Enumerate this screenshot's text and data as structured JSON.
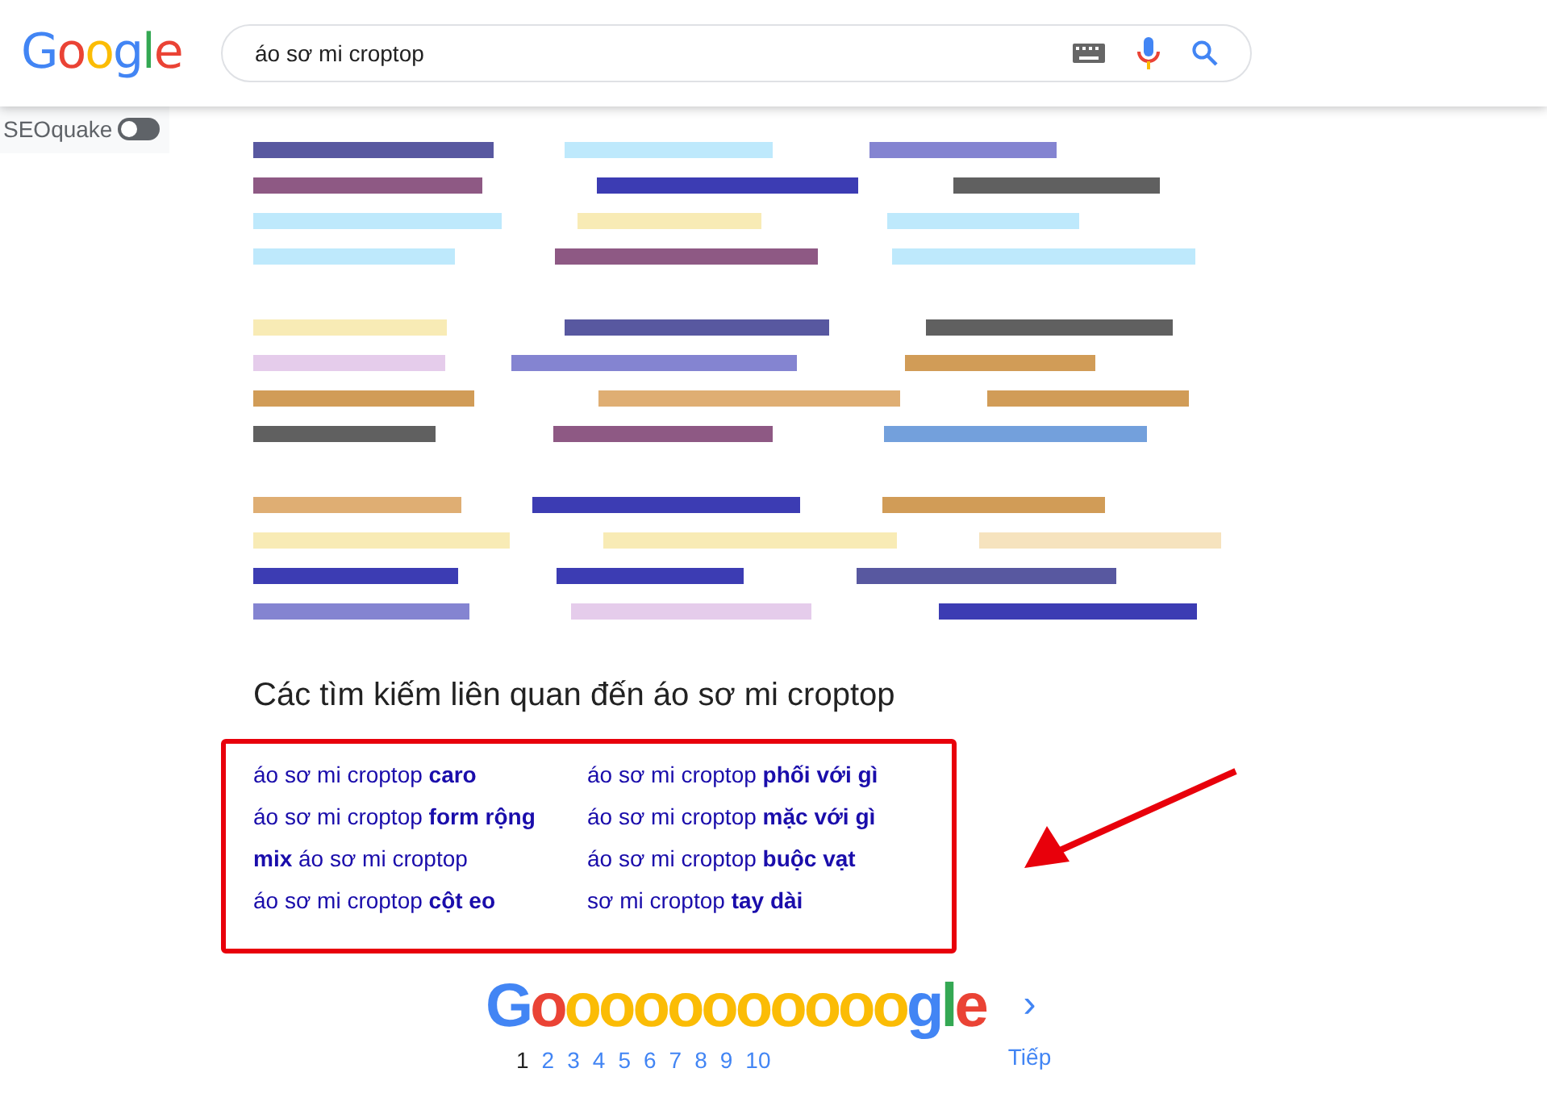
{
  "header": {
    "logo_letters": [
      {
        "text": "G",
        "color": "#4285f4"
      },
      {
        "text": "o",
        "color": "#ea4335"
      },
      {
        "text": "o",
        "color": "#fbbc05"
      },
      {
        "text": "g",
        "color": "#4285f4"
      },
      {
        "text": "l",
        "color": "#34a853"
      },
      {
        "text": "e",
        "color": "#ea4335"
      }
    ],
    "search": {
      "value": "áo sơ mi croptop"
    }
  },
  "seoquake": {
    "label": "SEOquake",
    "on": false
  },
  "related": {
    "title": "Các tìm kiếm liên quan đến áo sơ mi croptop",
    "columns": [
      [
        "áo sơ mi croptop **caro**",
        "áo sơ mi croptop **form rộng**",
        "**mix** áo sơ mi croptop",
        "áo sơ mi croptop **cột eo**"
      ],
      [
        "áo sơ mi croptop **phối với gì**",
        "áo sơ mi croptop **mặc với gì**",
        "áo sơ mi croptop **buộc vạt**",
        "sơ mi croptop **tay dài**"
      ]
    ]
  },
  "pagination": {
    "logo_letters": [
      {
        "text": "G",
        "color": "#4285f4"
      },
      {
        "text": "o",
        "color": "#ea4335"
      },
      {
        "text": "o",
        "color": "#fbbc05"
      },
      {
        "text": "o",
        "color": "#fbbc05"
      },
      {
        "text": "o",
        "color": "#fbbc05"
      },
      {
        "text": "o",
        "color": "#fbbc05"
      },
      {
        "text": "o",
        "color": "#fbbc05"
      },
      {
        "text": "o",
        "color": "#fbbc05"
      },
      {
        "text": "o",
        "color": "#fbbc05"
      },
      {
        "text": "o",
        "color": "#fbbc05"
      },
      {
        "text": "o",
        "color": "#fbbc05"
      },
      {
        "text": "o",
        "color": "#fbbc05"
      },
      {
        "text": "g",
        "color": "#4285f4"
      },
      {
        "text": "l",
        "color": "#34a853"
      },
      {
        "text": "e",
        "color": "#ea4335"
      }
    ],
    "pages": [
      {
        "label": "1",
        "selected": true
      },
      {
        "label": "2",
        "selected": false
      },
      {
        "label": "3",
        "selected": false
      },
      {
        "label": "4",
        "selected": false
      },
      {
        "label": "5",
        "selected": false
      },
      {
        "label": "6",
        "selected": false
      },
      {
        "label": "7",
        "selected": false
      },
      {
        "label": "8",
        "selected": false
      },
      {
        "label": "9",
        "selected": false
      },
      {
        "label": "10",
        "selected": false
      }
    ],
    "next": {
      "arrow": "›",
      "label": "Tiếp"
    }
  }
}
